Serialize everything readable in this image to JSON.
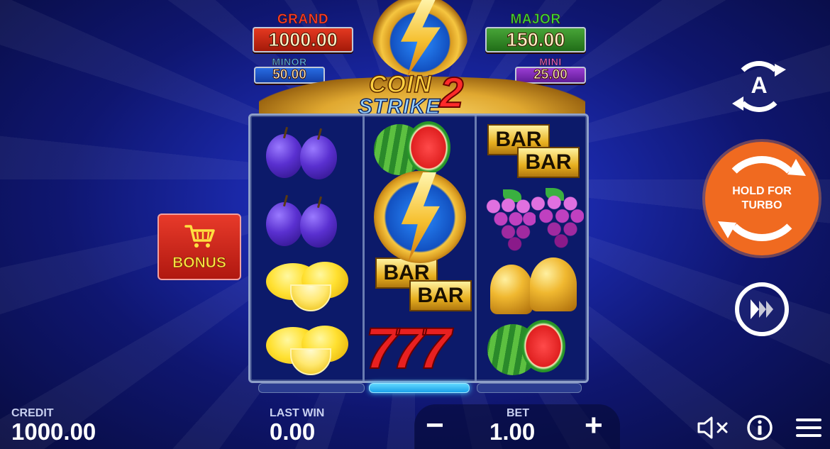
{
  "jackpots": {
    "grand": {
      "label": "GRAND",
      "value": "1000.00",
      "label_color": "#ff3a2a",
      "plate_color": "#d02a18"
    },
    "major": {
      "label": "MAJOR",
      "value": "150.00",
      "label_color": "#3ad83a",
      "plate_color": "#2a8a22"
    },
    "minor": {
      "label": "MINOR",
      "value": "50.00",
      "label_color": "#4ab0ff",
      "plate_color": "#1a5ad0"
    },
    "mini": {
      "label": "MINI",
      "value": "25.00",
      "label_color": "#e060e0",
      "plate_color": "#8a2ac0"
    }
  },
  "logo": {
    "line1": "COIN",
    "line2": "STRIKE",
    "number": "2"
  },
  "reels": {
    "reel1": [
      "plum",
      "plum",
      "lemon",
      "lemon"
    ],
    "reel2": [
      "watermelon",
      "lightning-coin",
      "bar",
      "seven"
    ],
    "reel3": [
      "bar",
      "grapes",
      "bell",
      "watermelon"
    ],
    "bar_text": "BAR",
    "seven_text": "777",
    "active_reel": 2
  },
  "bonus": {
    "label": "BONUS",
    "icon": "cart-icon"
  },
  "controls": {
    "autoplay_letter": "A",
    "spin_label_line1": "HOLD FOR",
    "spin_label_line2": "TURBO",
    "spin_color": "#f06a20"
  },
  "footer": {
    "credit_label": "CREDIT",
    "credit_value": "1000.00",
    "last_win_label": "LAST WIN",
    "last_win_value": "0.00",
    "bet_label": "BET",
    "bet_value": "1.00",
    "minus": "−",
    "plus": "+"
  }
}
